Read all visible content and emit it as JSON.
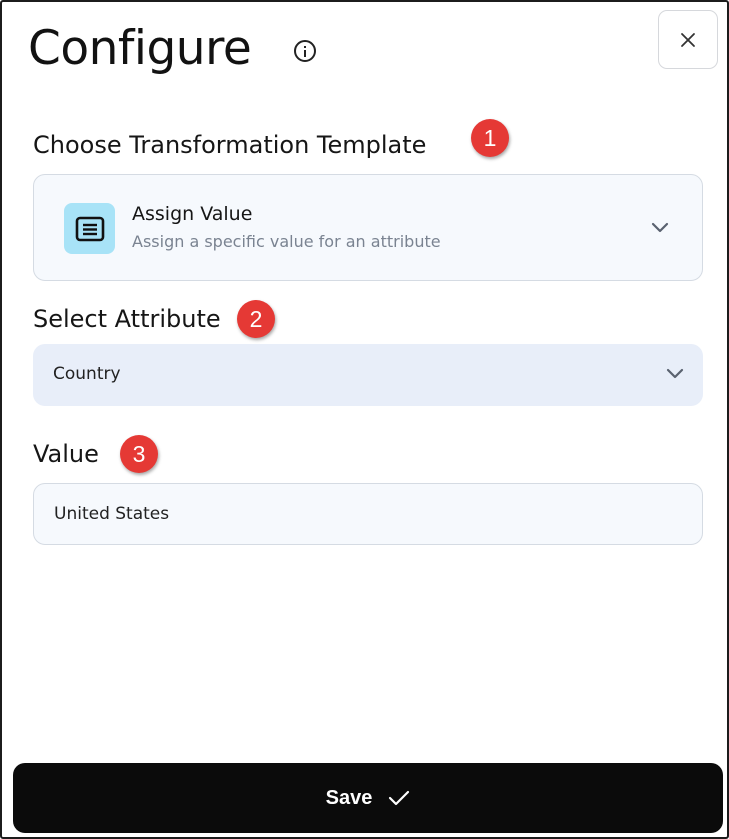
{
  "header": {
    "title": "Configure",
    "info_icon": "info-circle-icon",
    "close_icon": "close-icon"
  },
  "steps": {
    "template": {
      "label": "Choose Transformation Template",
      "badge": "1"
    },
    "attribute": {
      "label": "Select Attribute",
      "badge": "2"
    },
    "value": {
      "label": "Value",
      "badge": "3"
    }
  },
  "template_select": {
    "icon": "document-lines-icon",
    "title": "Assign Value",
    "description": "Assign a specific value for an attribute"
  },
  "attribute_select": {
    "selected": "Country"
  },
  "value_input": {
    "value": "United States"
  },
  "footer": {
    "save_label": "Save",
    "save_icon": "checkmark-icon"
  },
  "colors": {
    "badge": "#e53935",
    "template_icon_bg": "#a8e3f7",
    "attribute_bg": "#e8eef9",
    "save_bg": "#0b0b0b"
  }
}
